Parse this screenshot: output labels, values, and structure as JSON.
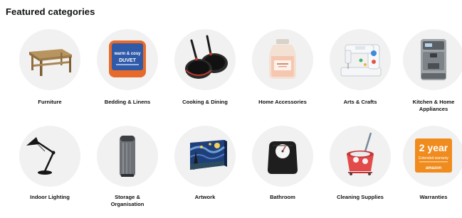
{
  "section": {
    "title": "Featured categories"
  },
  "categories": [
    {
      "label": "Furniture",
      "icon": "coffee-table-icon"
    },
    {
      "label": "Bedding & Linens",
      "icon": "duvet-package-icon",
      "package_text_1": "warm & cosy",
      "package_text_2": "DUVET"
    },
    {
      "label": "Cooking & Dining",
      "icon": "frying-pans-icon"
    },
    {
      "label": "Home Accessories",
      "icon": "candle-jar-icon"
    },
    {
      "label": "Arts & Crafts",
      "icon": "sewing-machine-icon"
    },
    {
      "label_line_1": "Kitchen & Home",
      "label_line_2": "Appliances",
      "icon": "coffee-machine-icon"
    },
    {
      "label": "Indoor Lighting",
      "icon": "desk-lamp-icon"
    },
    {
      "label_line_1": "Storage &",
      "label_line_2": "Organisation",
      "icon": "pedal-bin-icon"
    },
    {
      "label": "Artwork",
      "icon": "canvas-painting-icon"
    },
    {
      "label": "Bathroom",
      "icon": "bathroom-scale-icon"
    },
    {
      "label": "Cleaning Supplies",
      "icon": "mop-bucket-icon"
    },
    {
      "label": "Warranties",
      "icon": "warranty-card-icon",
      "card_title": "2 year",
      "card_text": "Extended warranty",
      "card_brand": "amazon"
    }
  ],
  "colors": {
    "circle_bg": "#f1f1f1",
    "warranty_orange": "#f08c1e",
    "duvet_orange": "#e86a2a",
    "duvet_blue": "#2f5aa8"
  }
}
